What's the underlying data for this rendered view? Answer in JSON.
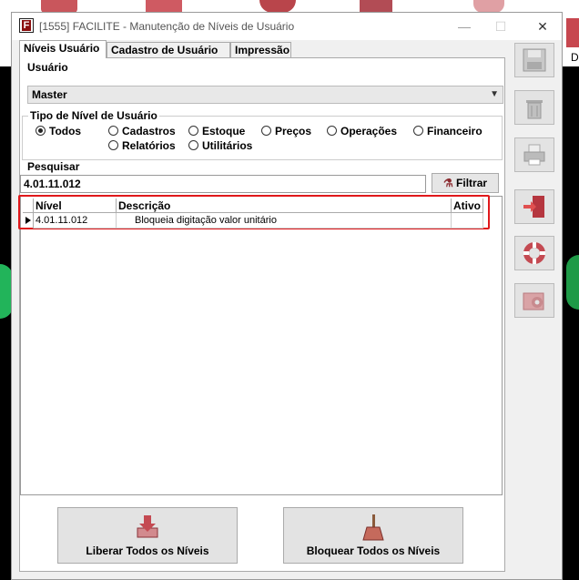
{
  "window": {
    "title": "[1555] FACILITE - Manutenção de Níveis de Usuário",
    "app_icon_letter": "F",
    "minimize_glyph": "—",
    "maximize_glyph": "☐",
    "close_glyph": "✕"
  },
  "tabs": [
    {
      "label": "Níveis Usuário",
      "active": true
    },
    {
      "label": "Cadastro de Usuário",
      "active": false
    },
    {
      "label": "Impressão",
      "active": false
    }
  ],
  "usuario": {
    "label": "Usuário",
    "selected": "Master"
  },
  "tipo_nivel": {
    "label": "Tipo de Nível de Usuário",
    "options": [
      {
        "label": "Todos",
        "checked": true
      },
      {
        "label": "Cadastros",
        "checked": false
      },
      {
        "label": "Estoque",
        "checked": false
      },
      {
        "label": "Preços",
        "checked": false
      },
      {
        "label": "Operações",
        "checked": false
      },
      {
        "label": "Financeiro",
        "checked": false
      },
      {
        "label": "Relatórios",
        "checked": false
      },
      {
        "label": "Utilitários",
        "checked": false
      }
    ]
  },
  "pesquisar": {
    "label": "Pesquisar",
    "value": "4.01.11.012",
    "filter_button": "Filtrar"
  },
  "grid": {
    "columns": [
      "Nível",
      "Descrição",
      "Ativo"
    ],
    "rows": [
      {
        "nivel": "4.01.11.012",
        "descricao": "Bloqueia digitação valor unitário",
        "ativo": ""
      }
    ]
  },
  "actions": {
    "liberar": "Liberar Todos os Níveis",
    "bloquear": "Bloquear Todos os Níveis"
  },
  "toolbar": {
    "icons": [
      "save-icon",
      "trash-icon",
      "printer-icon",
      "exit-door-icon",
      "lifebuoy-icon",
      "settings-icon"
    ]
  },
  "desktop": {
    "right_edge_text": "D"
  },
  "colors": {
    "accent": "#b5363f",
    "highlight": "#e0181b",
    "panel": "#f0f0f0"
  }
}
